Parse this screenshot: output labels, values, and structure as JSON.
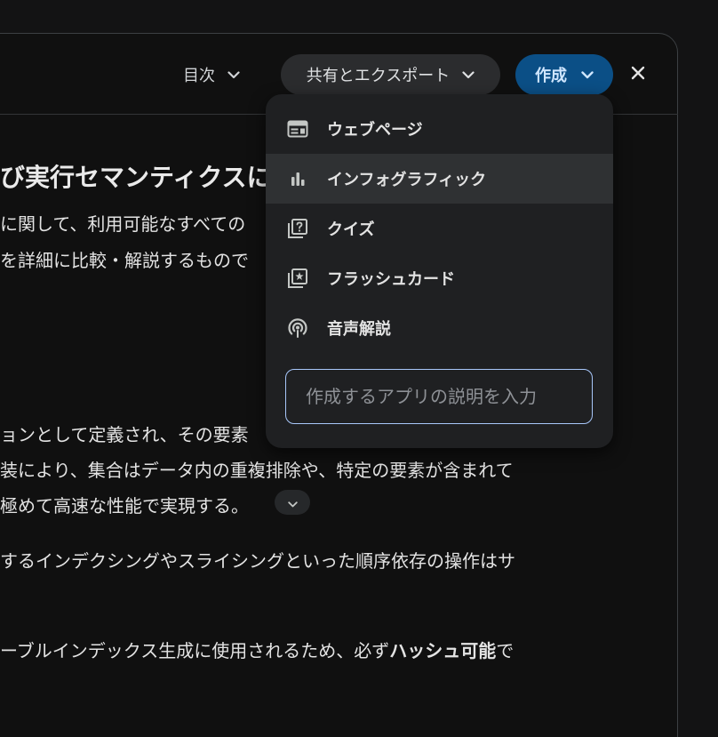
{
  "header": {
    "toc_label": "目次",
    "share_label": "共有とエクスポート",
    "create_label": "作成"
  },
  "document": {
    "heading": "び実行セマンティクスに",
    "lines": [
      "に関して、利用可能なすべての",
      "を詳細に比較・解説するもので",
      "ョンとして定義され、その要素",
      "装により、集合はデータ内の重複排除や、特定の要素が含まれて",
      "極めて高速な性能で実現する。",
      "するインデクシングやスライシングといった順序依存の操作はサ",
      "ーブルインデックス生成に使用されるため、必ず"
    ],
    "bold_fragment": "ハッシュ可能",
    "line7_tail": "で"
  },
  "menu": {
    "items": [
      {
        "label": "ウェブページ",
        "icon": "webpage-icon"
      },
      {
        "label": "インフォグラフィック",
        "icon": "bar-chart-icon"
      },
      {
        "label": "クイズ",
        "icon": "quiz-icon"
      },
      {
        "label": "フラッシュカード",
        "icon": "flashcard-icon"
      },
      {
        "label": "音声解説",
        "icon": "podcast-icon"
      }
    ],
    "input_placeholder": "作成するアプリの説明を入力"
  }
}
